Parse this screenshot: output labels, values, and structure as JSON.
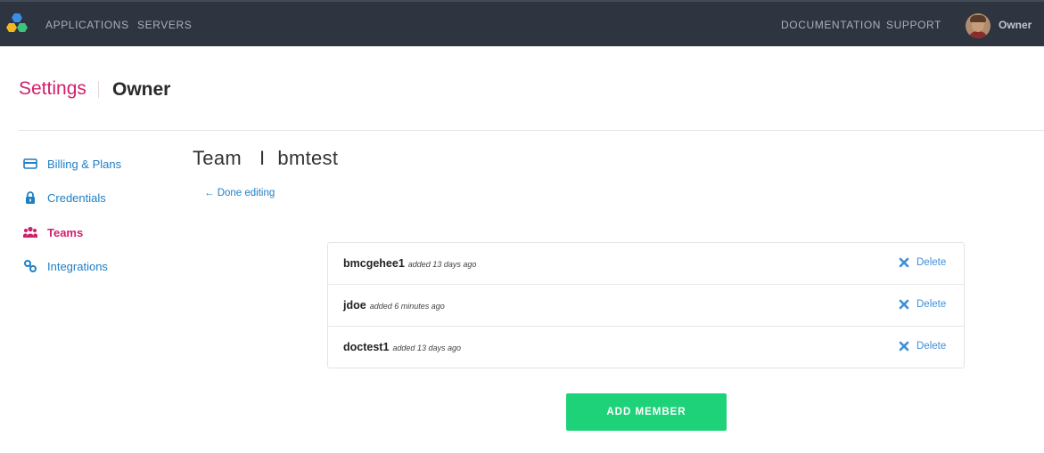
{
  "topbar": {
    "nav": {
      "applications": "APPLICATIONS",
      "servers": "SERVERS",
      "documentation": "DOCUMENTATION",
      "support": "SUPPORT"
    },
    "user_name": "Owner"
  },
  "header": {
    "section": "Settings",
    "account": "Owner"
  },
  "sidebar": {
    "items": [
      {
        "label": "Billing & Plans",
        "icon": "credit-card-icon",
        "active": false
      },
      {
        "label": "Credentials",
        "icon": "lock-icon",
        "active": false
      },
      {
        "label": "Teams",
        "icon": "users-icon",
        "active": true
      },
      {
        "label": "Integrations",
        "icon": "link-icon",
        "active": false
      }
    ]
  },
  "main": {
    "title": "Team",
    "separator": "I",
    "team_name": "bmtest",
    "done_editing": "← Done editing",
    "members": [
      {
        "name": "bmcgehee1",
        "added": "added 13 days ago",
        "delete_label": "Delete"
      },
      {
        "name": "jdoe",
        "added": "added 6 minutes ago",
        "delete_label": "Delete"
      },
      {
        "name": "doctest1",
        "added": "added 13 days ago",
        "delete_label": "Delete"
      }
    ],
    "add_member_label": "ADD MEMBER"
  },
  "colors": {
    "topbar": "#2e3440",
    "accent_pink": "#d21f6b",
    "link_blue": "#1f7fc4",
    "button_green": "#1dd278"
  }
}
